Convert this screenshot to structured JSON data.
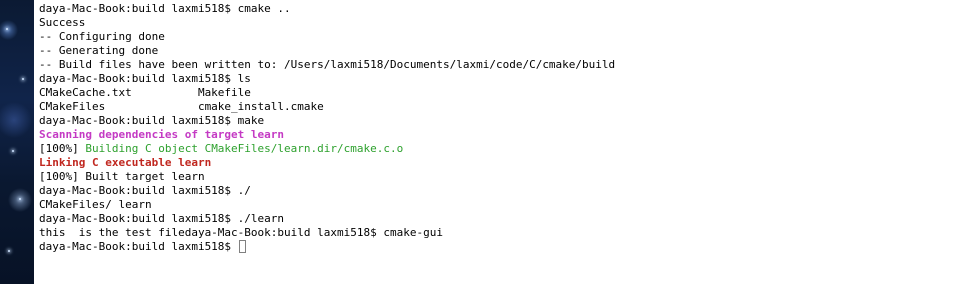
{
  "terminal": {
    "lines": [
      "daya-Mac-Book:build laxmi518$ cmake ..",
      "Success",
      "-- Configuring done",
      "-- Generating done",
      "-- Build files have been written to: /Users/laxmi518/Documents/laxmi/code/C/cmake/build",
      "daya-Mac-Book:build laxmi518$ ls",
      "CMakeCache.txt          Makefile",
      "CMakeFiles              cmake_install.cmake",
      "daya-Mac-Book:build laxmi518$ make",
      "Scanning dependencies of target learn",
      "[100%] ",
      "Building C object CMakeFiles/learn.dir/cmake.c.o",
      "Linking C executable learn",
      "[100%] Built target learn",
      "daya-Mac-Book:build laxmi518$ ./",
      "CMakeFiles/ learn",
      "daya-Mac-Book:build laxmi518$ ./learn",
      "this  is the test filedaya-Mac-Book:build laxmi518$ cmake-gui",
      "daya-Mac-Book:build laxmi518$ "
    ]
  },
  "colors": {
    "scanning": "#c43ac4",
    "building": "#2ea12e",
    "linking": "#c0271f",
    "background": "#ffffff",
    "text": "#000000"
  }
}
